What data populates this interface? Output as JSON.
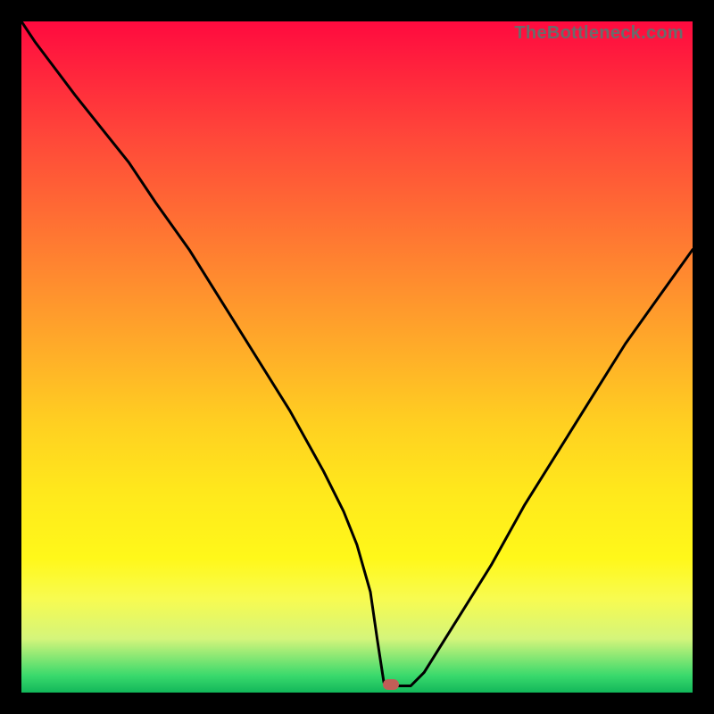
{
  "watermark": "TheBottleneck.com",
  "colors": {
    "frame": "#000000",
    "curve": "#000000",
    "marker": "#c15d57"
  },
  "chart_data": {
    "type": "line",
    "title": "",
    "xlabel": "",
    "ylabel": "",
    "xlim": [
      0,
      100
    ],
    "ylim": [
      0,
      100
    ],
    "grid": false,
    "legend": false,
    "series": [
      {
        "name": "bottleneck-curve",
        "x": [
          0,
          2,
          5,
          8,
          12,
          16,
          20,
          25,
          30,
          35,
          40,
          45,
          48,
          50,
          52,
          53,
          54,
          56,
          58,
          60,
          65,
          70,
          75,
          80,
          85,
          90,
          95,
          100
        ],
        "y": [
          100,
          97,
          93,
          89,
          84,
          79,
          73,
          66,
          58,
          50,
          42,
          33,
          27,
          22,
          15,
          8,
          1.5,
          1,
          1,
          3,
          11,
          19,
          28,
          36,
          44,
          52,
          59,
          66
        ]
      }
    ],
    "marker": {
      "x": 55,
      "y": 1.2
    },
    "background": "vertical-rainbow-heat-gradient"
  }
}
